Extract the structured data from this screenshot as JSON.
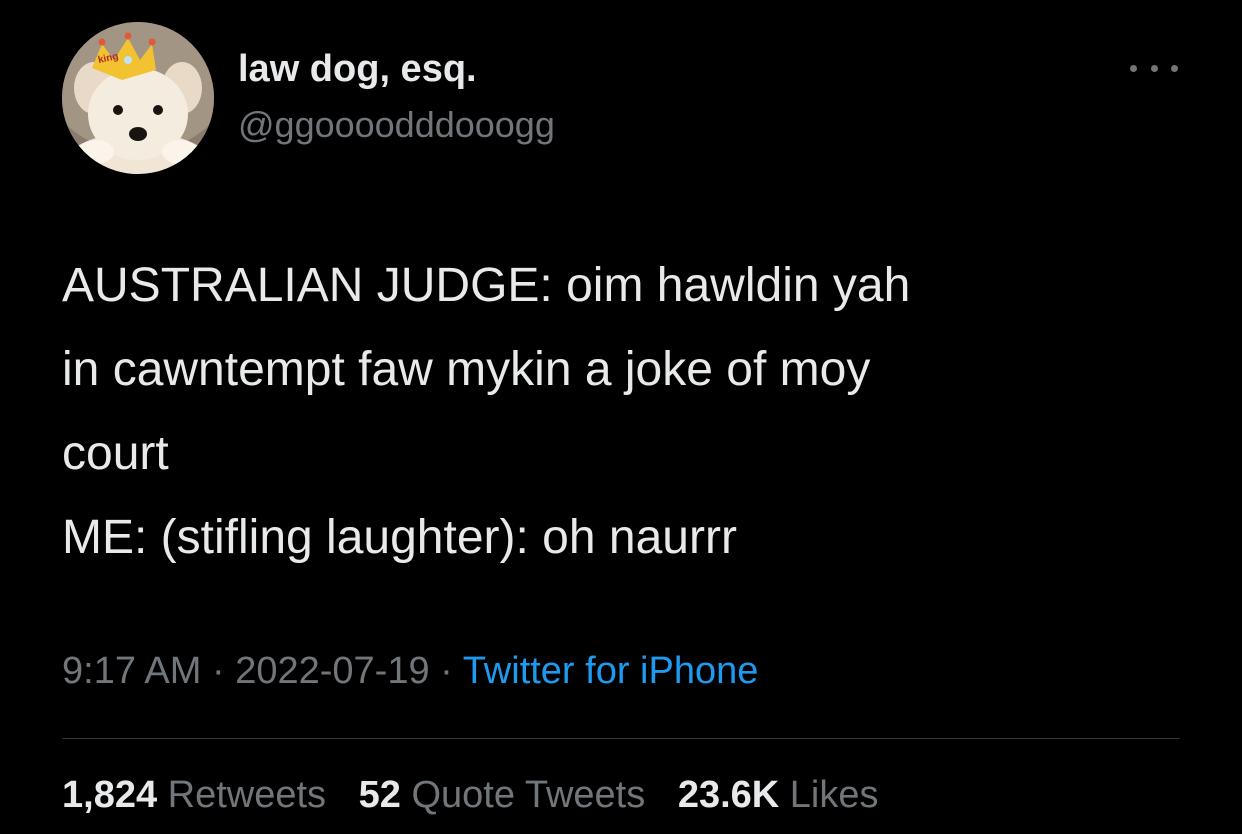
{
  "avatar": {
    "crown_label": "king",
    "icon": "dog-avatar-with-crown"
  },
  "author": {
    "display_name": "law dog, esq.",
    "handle": "@ggoooodddooogg"
  },
  "more_icon": "more-horizontal-icon",
  "tweet": {
    "lines": [
      "AUSTRALIAN JUDGE: oim hawldin yah",
      "in cawntempt faw mykin a joke of moy",
      "court",
      "ME: (stifling laughter): oh naurrr"
    ]
  },
  "meta": {
    "time": "9:17 AM",
    "separator": "·",
    "date": "2022-07-19",
    "source": "Twitter for iPhone"
  },
  "stats": {
    "retweets_count": "1,824",
    "retweets_label": "Retweets",
    "quotes_count": "52",
    "quotes_label": "Quote Tweets",
    "likes_count": "23.6K",
    "likes_label": "Likes"
  },
  "colors": {
    "background": "#000000",
    "text_primary": "#e7e9ea",
    "text_secondary": "#71767b",
    "link": "#1d9bf0",
    "divider": "#2f3336"
  }
}
